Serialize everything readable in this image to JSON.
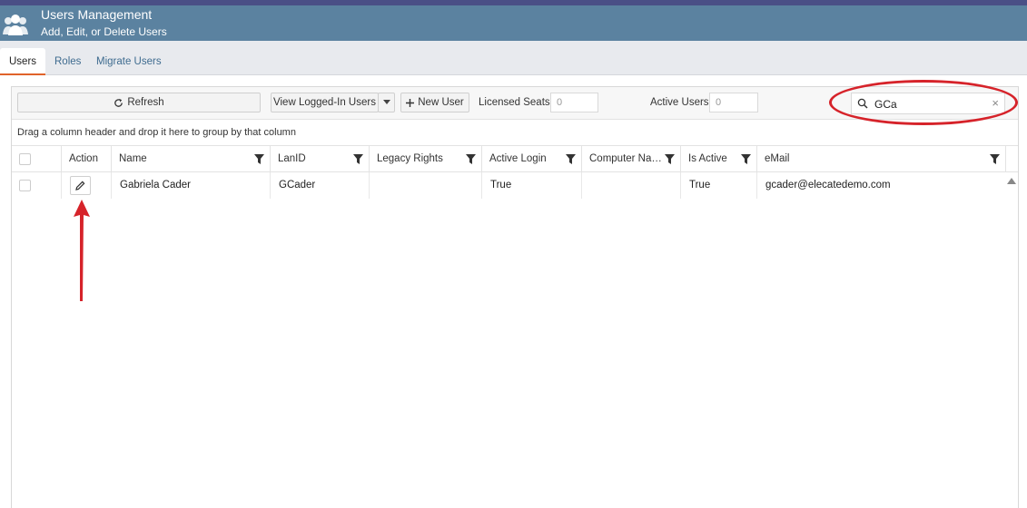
{
  "header": {
    "title": "Users Management",
    "subtitle": "Add, Edit, or Delete Users"
  },
  "tabs": [
    {
      "label": "Users",
      "active": true
    },
    {
      "label": "Roles",
      "active": false
    },
    {
      "label": "Migrate Users",
      "active": false
    }
  ],
  "toolbar": {
    "refresh_label": "Refresh",
    "view_logged_in_label": "View Logged-In Users",
    "new_user_label": "New User",
    "licensed_seats_label": "Licensed Seats",
    "licensed_seats_value": "0",
    "active_users_label": "Active Users",
    "active_users_value": "0",
    "search_value": "GCa"
  },
  "grouping_hint": "Drag a column header and drop it here to group by that column",
  "columns": {
    "action": "Action",
    "name": "Name",
    "lanid": "LanID",
    "legacy_rights": "Legacy Rights",
    "active_login": "Active Login",
    "computer_name": "Computer Na…",
    "is_active": "Is Active",
    "email": "eMail"
  },
  "rows": [
    {
      "name": "Gabriela Cader",
      "lanid": "GCader",
      "legacy_rights": "",
      "active_login": "True",
      "computer_name": "",
      "is_active": "True",
      "email": "gcader@elecatedemo.com"
    }
  ],
  "colors": {
    "header_bg": "#5b82a0",
    "accent_tab": "#e0632a",
    "annotation_red": "#d6232a"
  }
}
